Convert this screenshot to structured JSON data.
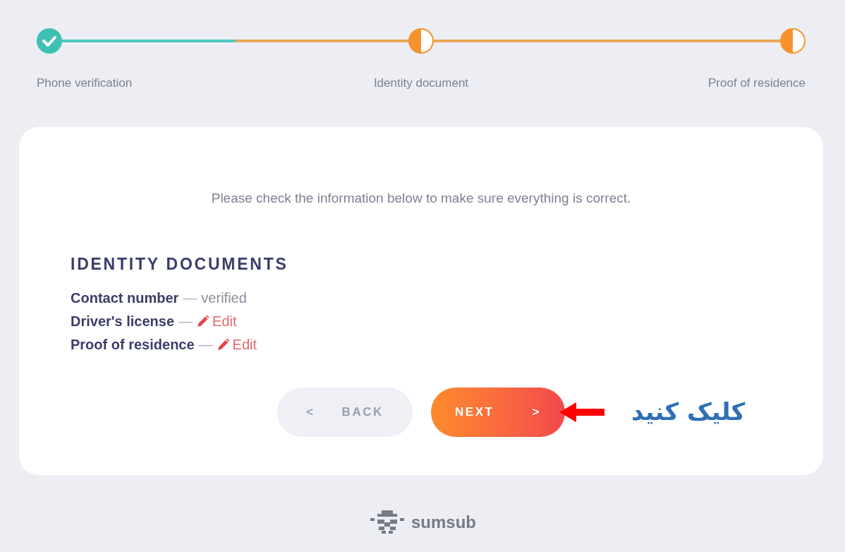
{
  "steps": [
    {
      "label": "Phone verification",
      "completed": true
    },
    {
      "label": "Identity document",
      "completed": false
    },
    {
      "label": "Proof of residence",
      "completed": false
    }
  ],
  "card": {
    "intro": "Please check the information below to make sure everything is correct.",
    "section_title": "IDENTITY DOCUMENTS",
    "items": [
      {
        "label": "Contact number",
        "separator": "—",
        "kind": "status",
        "value": "verified"
      },
      {
        "label": "Driver's license",
        "separator": "—",
        "kind": "edit",
        "value": "Edit"
      },
      {
        "label": "Proof of residence",
        "separator": "—",
        "kind": "edit",
        "value": "Edit"
      }
    ],
    "back_button": {
      "icon": "<",
      "label": "BACK"
    },
    "next_button": {
      "label": "NEXT",
      "icon": ">"
    }
  },
  "annotation": {
    "text": "کلیک کنید"
  },
  "footer": {
    "logo_text": "sumsub"
  }
}
